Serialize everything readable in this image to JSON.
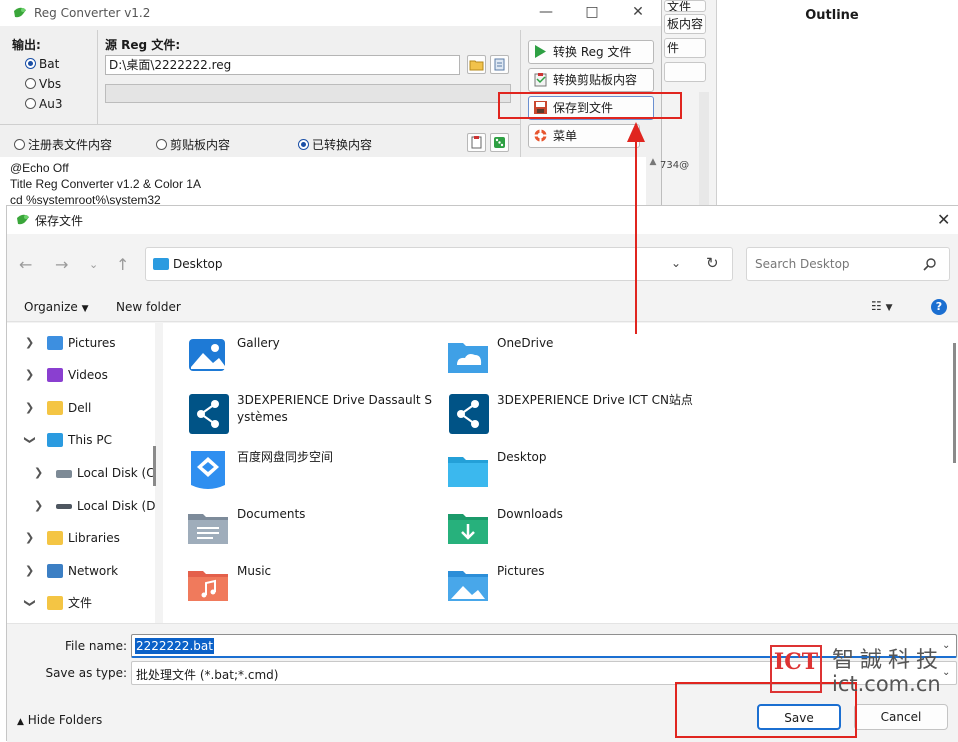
{
  "background_app": {
    "outline_title": "Outline",
    "fragment_buttons": [
      "文件",
      "板内容",
      "件"
    ],
    "side_number": "734@"
  },
  "reg_converter": {
    "title": "Reg Converter v1.2",
    "output_label": "输出:",
    "output_options": [
      {
        "label": "Bat",
        "selected": true
      },
      {
        "label": "Vbs",
        "selected": false
      },
      {
        "label": "Au3",
        "selected": false
      }
    ],
    "source_label": "源 Reg 文件:",
    "source_path": "D:\\桌面\\2222222.reg",
    "buttons": {
      "convert_reg": "转换 Reg 文件",
      "convert_clipboard": "转换剪贴板内容",
      "save_to_file": "保存到文件",
      "menu": "菜单"
    },
    "view_options": [
      {
        "label": "注册表文件内容",
        "selected": false
      },
      {
        "label": "剪贴板内容",
        "selected": false
      },
      {
        "label": "已转换内容",
        "selected": true
      }
    ],
    "code_lines": [
      "@Echo Off",
      "Title Reg Converter v1.2 & Color 1A",
      "cd %systemroot%\\system32"
    ]
  },
  "save_dialog": {
    "title": "保存文件",
    "address": "Desktop",
    "search_placeholder": "Search Desktop",
    "toolbar": {
      "organize": "Organize",
      "new_folder": "New folder"
    },
    "nav_items": [
      {
        "label": "Pictures",
        "expanded": false,
        "indent": 0,
        "icon": "pictures"
      },
      {
        "label": "Videos",
        "expanded": false,
        "indent": 0,
        "icon": "videos"
      },
      {
        "label": "Dell",
        "expanded": false,
        "indent": 0,
        "icon": "folder"
      },
      {
        "label": "This PC",
        "expanded": true,
        "indent": 0,
        "icon": "pc"
      },
      {
        "label": "Local Disk (C",
        "expanded": false,
        "indent": 1,
        "icon": "disk"
      },
      {
        "label": "Local Disk (D",
        "expanded": false,
        "indent": 1,
        "icon": "disk"
      },
      {
        "label": "Libraries",
        "expanded": false,
        "indent": 0,
        "icon": "folder"
      },
      {
        "label": "Network",
        "expanded": false,
        "indent": 0,
        "icon": "network"
      },
      {
        "label": "文件",
        "expanded": true,
        "indent": 0,
        "icon": "folder"
      }
    ],
    "files": [
      {
        "name": "Gallery",
        "icon": "gallery"
      },
      {
        "name": "OneDrive",
        "icon": "onedrive"
      },
      {
        "name": "3DEXPERIENCE Drive Dassault Systèmes",
        "icon": "3dx"
      },
      {
        "name": "3DEXPERIENCE Drive ICT CN站点",
        "icon": "3dx"
      },
      {
        "name": "百度网盘同步空间",
        "icon": "baidu"
      },
      {
        "name": "Desktop",
        "icon": "desktop"
      },
      {
        "name": "Documents",
        "icon": "documents"
      },
      {
        "name": "Downloads",
        "icon": "downloads"
      },
      {
        "name": "Music",
        "icon": "music"
      },
      {
        "name": "Pictures",
        "icon": "pictures-folder"
      }
    ],
    "file_name_label": "File name:",
    "file_name_value": "2222222.bat",
    "save_type_label": "Save as type:",
    "save_type_value": "批处理文件 (*.bat;*.cmd)",
    "hide_folders": "Hide Folders",
    "save_button": "Save",
    "cancel_button": "Cancel"
  },
  "watermark": {
    "logo_text": "ICT",
    "cn_text": "智誠科技",
    "url": "ict.com.cn"
  },
  "colors": {
    "accent": "#1b6fd1",
    "highlight": "#e0251f"
  }
}
